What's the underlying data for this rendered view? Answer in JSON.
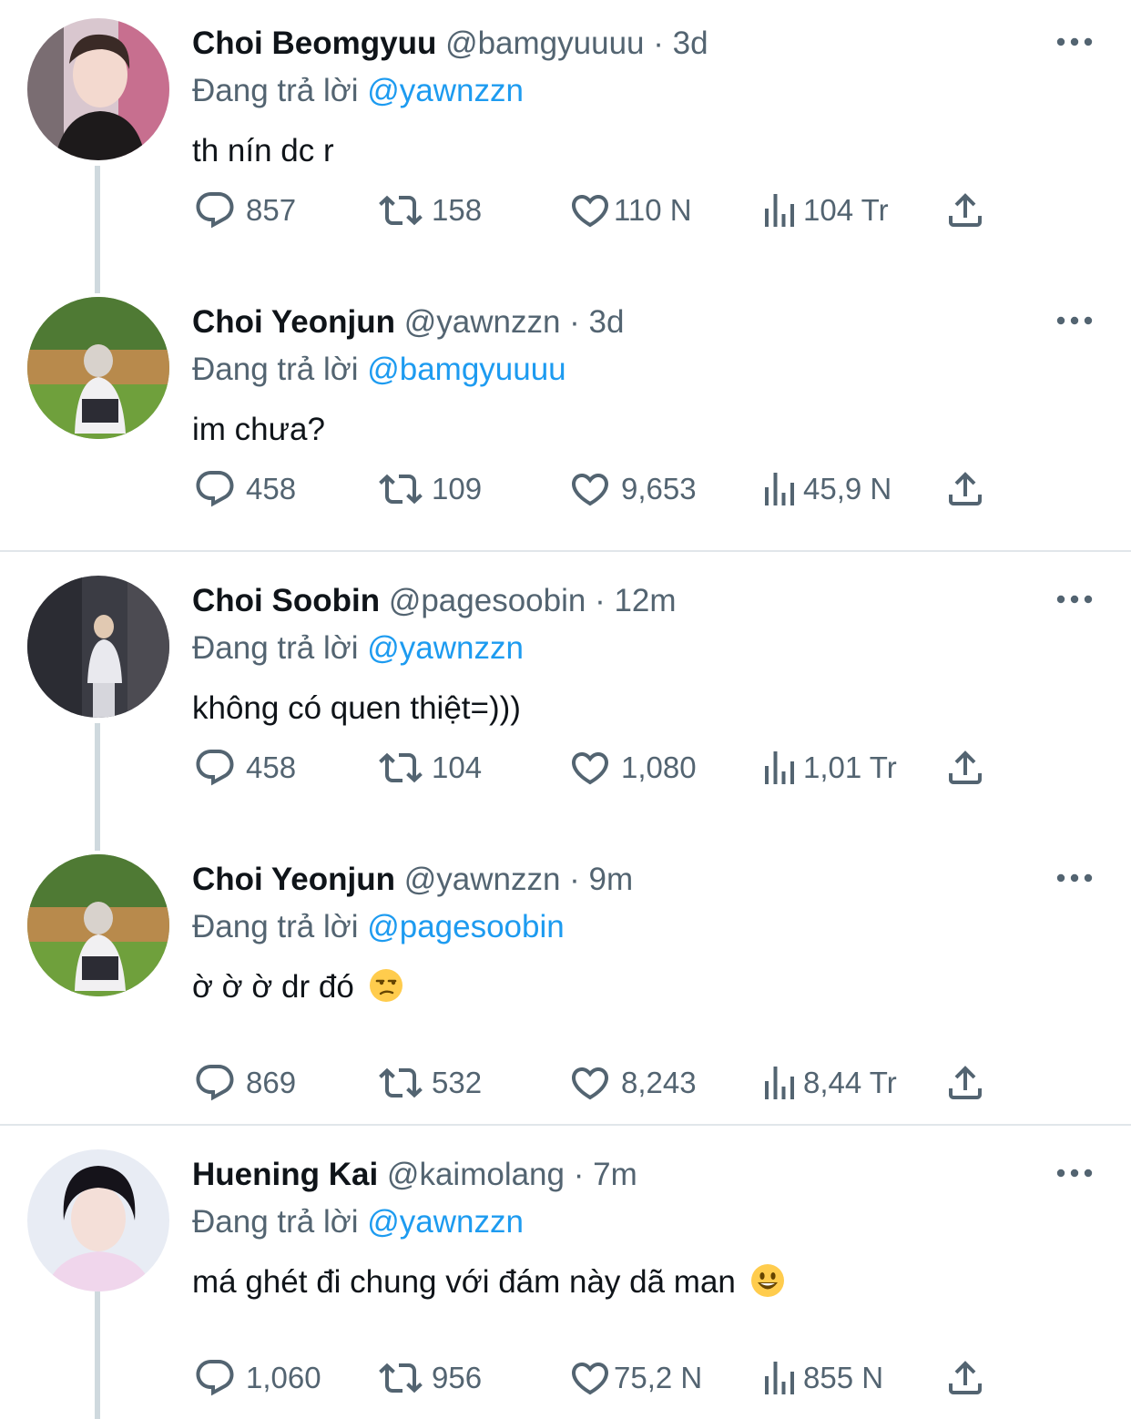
{
  "tweets": [
    {
      "name": "Choi Beomgyuu",
      "handle": "@bamgyuuuu",
      "time": "3d",
      "reply_prefix": "Đang trả lời",
      "reply_to": "@yawnzzn",
      "text": "th nín dc r",
      "emoji": "",
      "counts": {
        "replies": "857",
        "retweets": "158",
        "likes": "110 N",
        "views": "104 Tr"
      },
      "avatar": "avatar-beomgyu"
    },
    {
      "name": "Choi Yeonjun",
      "handle": "@yawnzzn",
      "time": "3d",
      "reply_prefix": "Đang trả lời",
      "reply_to": "@bamgyuuuu",
      "text": "im chưa?",
      "emoji": "",
      "counts": {
        "replies": "458",
        "retweets": "109",
        "likes": "9,653",
        "views": "45,9 N"
      },
      "avatar": "avatar-yeonjun"
    },
    {
      "name": "Choi Soobin",
      "handle": "@pagesoobin",
      "time": "12m",
      "reply_prefix": "Đang trả lời",
      "reply_to": "@yawnzzn",
      "text": "không có quen thiệt=)))",
      "emoji": "",
      "counts": {
        "replies": "458",
        "retweets": "104",
        "likes": "1,080",
        "views": "1,01 Tr"
      },
      "avatar": "avatar-soobin"
    },
    {
      "name": "Choi Yeonjun",
      "handle": "@yawnzzn",
      "time": "9m",
      "reply_prefix": "Đang trả lời",
      "reply_to": "@pagesoobin",
      "text": "ờ ờ ờ dr đó",
      "emoji": "unamused-face",
      "counts": {
        "replies": "869",
        "retweets": "532",
        "likes": "8,243",
        "views": "8,44 Tr"
      },
      "avatar": "avatar-yeonjun"
    },
    {
      "name": "Huening Kai",
      "handle": "@kaimolang",
      "time": "7m",
      "reply_prefix": "Đang trả lời",
      "reply_to": "@yawnzzn",
      "text": "má ghét đi chung với đám này dã man",
      "emoji": "smiley-face",
      "counts": {
        "replies": "1,060",
        "retweets": "956",
        "likes": "75,2 N",
        "views": "855 N"
      },
      "avatar": "avatar-kai"
    }
  ],
  "separator": "·",
  "icons": [
    "reply-icon",
    "retweet-icon",
    "like-icon",
    "views-icon",
    "share-icon",
    "more-icon"
  ],
  "colors": {
    "link": "#1d9bf0",
    "secondary": "#536471",
    "text": "#0f1419",
    "thread_line": "#cfd9de"
  }
}
